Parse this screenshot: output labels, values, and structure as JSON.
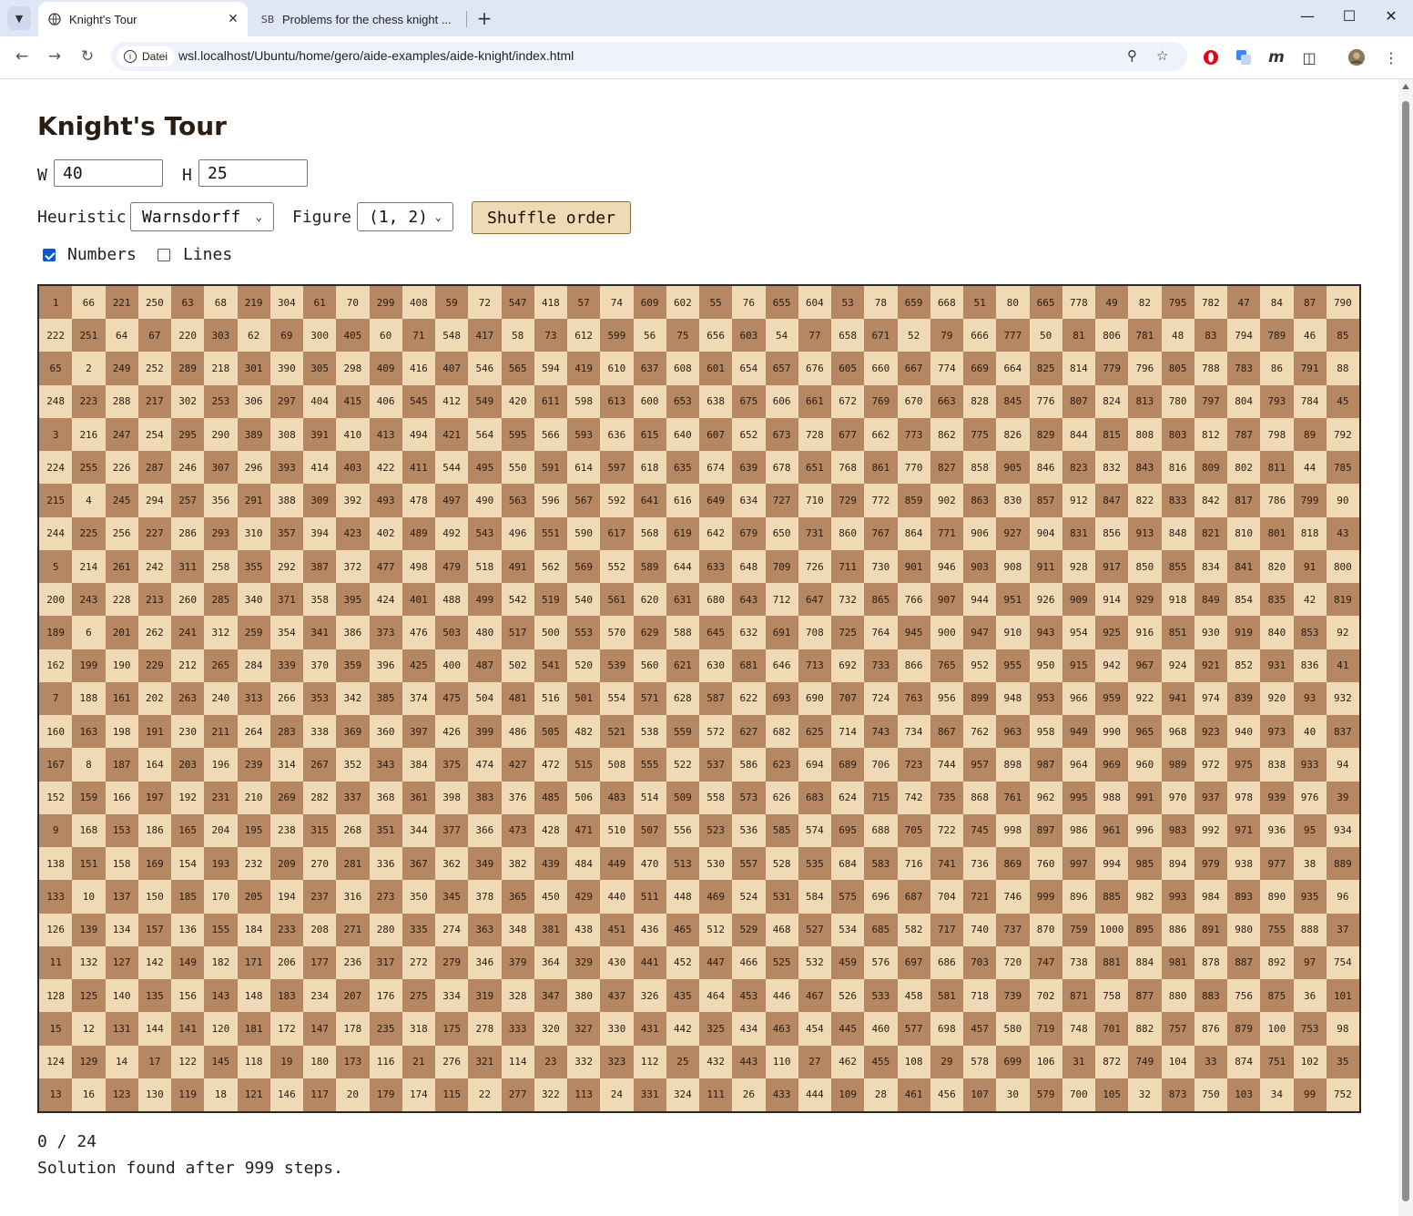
{
  "browser": {
    "tabs": [
      {
        "title": "Knight's Tour",
        "active": true
      },
      {
        "title": "Problems for the chess knight ...",
        "active": false,
        "favicon_text": "SB"
      }
    ],
    "security_chip": "Datei",
    "url": "wsl.localhost/Ubuntu/home/gero/aide-examples/aide-knight/index.html"
  },
  "page": {
    "title": "Knight's Tour",
    "w_label": "W",
    "w_value": "40",
    "h_label": "H",
    "h_value": "25",
    "heuristic_label": "Heuristic",
    "heuristic_value": "Warnsdorff",
    "figure_label": "Figure",
    "figure_value": "(1, 2)",
    "shuffle_label": "Shuffle order",
    "numbers_label": "Numbers",
    "numbers_checked": true,
    "lines_label": "Lines",
    "lines_checked": false,
    "counter": "0 / 24",
    "message": "Solution found after 999 steps."
  },
  "colors": {
    "light_square": "#f0d9b5",
    "dark_square": "#b58863",
    "button_bg": "#f0d9b5",
    "checkbox_accent": "#0b57d0"
  },
  "board": {
    "width": 40,
    "height": 25,
    "rows": [
      [
        1,
        66,
        221,
        250,
        63,
        68,
        219,
        304,
        61,
        70,
        299,
        408,
        59,
        72,
        547,
        418,
        57,
        74,
        609,
        602,
        55,
        76,
        655,
        604,
        53,
        78,
        659,
        668,
        51,
        80,
        665,
        778,
        49,
        82,
        795,
        782,
        47,
        84,
        87,
        790
      ],
      [
        222,
        251,
        64,
        67,
        220,
        303,
        62,
        69,
        300,
        405,
        60,
        71,
        548,
        417,
        58,
        73,
        612,
        599,
        56,
        75,
        656,
        603,
        54,
        77,
        658,
        671,
        52,
        79,
        666,
        777,
        50,
        81,
        806,
        781,
        48,
        83,
        794,
        789,
        46,
        85
      ],
      [
        65,
        2,
        249,
        252,
        289,
        218,
        301,
        390,
        305,
        298,
        409,
        416,
        407,
        546,
        565,
        594,
        419,
        610,
        637,
        608,
        601,
        654,
        657,
        676,
        605,
        660,
        667,
        774,
        669,
        664,
        825,
        814,
        779,
        796,
        805,
        788,
        783,
        86,
        791,
        88
      ],
      [
        248,
        223,
        288,
        217,
        302,
        253,
        306,
        297,
        404,
        415,
        406,
        545,
        412,
        549,
        420,
        611,
        598,
        613,
        600,
        653,
        638,
        675,
        606,
        661,
        672,
        769,
        670,
        663,
        828,
        845,
        776,
        807,
        824,
        813,
        780,
        797,
        804,
        793,
        784,
        45
      ],
      [
        3,
        216,
        247,
        254,
        295,
        290,
        389,
        308,
        391,
        410,
        413,
        494,
        421,
        564,
        595,
        566,
        593,
        636,
        615,
        640,
        607,
        652,
        673,
        728,
        677,
        662,
        773,
        862,
        775,
        826,
        829,
        844,
        815,
        808,
        803,
        812,
        787,
        798,
        89,
        792
      ],
      [
        224,
        255,
        226,
        287,
        246,
        307,
        296,
        393,
        414,
        403,
        422,
        411,
        544,
        495,
        550,
        591,
        614,
        597,
        618,
        635,
        674,
        639,
        678,
        651,
        768,
        861,
        770,
        827,
        858,
        905,
        846,
        823,
        832,
        843,
        816,
        809,
        802,
        811,
        44,
        785
      ],
      [
        215,
        4,
        245,
        294,
        257,
        356,
        291,
        388,
        309,
        392,
        493,
        478,
        497,
        490,
        563,
        596,
        567,
        592,
        641,
        616,
        649,
        634,
        727,
        710,
        729,
        772,
        859,
        902,
        863,
        830,
        857,
        912,
        847,
        822,
        833,
        842,
        817,
        786,
        799,
        90
      ],
      [
        244,
        225,
        256,
        227,
        286,
        293,
        310,
        357,
        394,
        423,
        402,
        489,
        492,
        543,
        496,
        551,
        590,
        617,
        568,
        619,
        642,
        679,
        650,
        731,
        860,
        767,
        864,
        771,
        906,
        927,
        904,
        831,
        856,
        913,
        848,
        821,
        810,
        801,
        818,
        43
      ],
      [
        5,
        214,
        261,
        242,
        311,
        258,
        355,
        292,
        387,
        372,
        477,
        498,
        479,
        518,
        491,
        562,
        569,
        552,
        589,
        644,
        633,
        648,
        709,
        726,
        711,
        730,
        901,
        946,
        903,
        908,
        911,
        928,
        917,
        850,
        855,
        834,
        841,
        820,
        91,
        800
      ],
      [
        200,
        243,
        228,
        213,
        260,
        285,
        340,
        371,
        358,
        395,
        424,
        401,
        488,
        499,
        542,
        519,
        540,
        561,
        620,
        631,
        680,
        643,
        712,
        647,
        732,
        865,
        766,
        907,
        944,
        951,
        926,
        909,
        914,
        929,
        918,
        849,
        854,
        835,
        42,
        819
      ],
      [
        189,
        6,
        201,
        262,
        241,
        312,
        259,
        354,
        341,
        386,
        373,
        476,
        503,
        480,
        517,
        500,
        553,
        570,
        629,
        588,
        645,
        632,
        691,
        708,
        725,
        764,
        945,
        900,
        947,
        910,
        943,
        954,
        925,
        916,
        851,
        930,
        919,
        840,
        853,
        92
      ],
      [
        162,
        199,
        190,
        229,
        212,
        265,
        284,
        339,
        370,
        359,
        396,
        425,
        400,
        487,
        502,
        541,
        520,
        539,
        560,
        621,
        630,
        681,
        646,
        713,
        692,
        733,
        866,
        765,
        952,
        955,
        950,
        915,
        942,
        967,
        924,
        921,
        852,
        931,
        836,
        41
      ],
      [
        7,
        188,
        161,
        202,
        263,
        240,
        313,
        266,
        353,
        342,
        385,
        374,
        475,
        504,
        481,
        516,
        501,
        554,
        571,
        628,
        587,
        622,
        693,
        690,
        707,
        724,
        763,
        956,
        899,
        948,
        953,
        966,
        959,
        922,
        941,
        974,
        839,
        920,
        93,
        932
      ],
      [
        160,
        163,
        198,
        191,
        230,
        211,
        264,
        283,
        338,
        369,
        360,
        397,
        426,
        399,
        486,
        505,
        482,
        521,
        538,
        559,
        572,
        627,
        682,
        625,
        714,
        743,
        734,
        867,
        762,
        963,
        958,
        949,
        990,
        965,
        968,
        923,
        940,
        973,
        40,
        837
      ],
      [
        167,
        8,
        187,
        164,
        203,
        196,
        239,
        314,
        267,
        352,
        343,
        384,
        375,
        474,
        427,
        472,
        515,
        508,
        555,
        522,
        537,
        586,
        623,
        694,
        689,
        706,
        723,
        744,
        957,
        898,
        987,
        964,
        969,
        960,
        989,
        972,
        975,
        838,
        933,
        94
      ],
      [
        152,
        159,
        166,
        197,
        192,
        231,
        210,
        269,
        282,
        337,
        368,
        361,
        398,
        383,
        376,
        485,
        506,
        483,
        514,
        509,
        558,
        573,
        626,
        683,
        624,
        715,
        742,
        735,
        868,
        761,
        962,
        995,
        988,
        991,
        970,
        937,
        978,
        939,
        976,
        39
      ],
      [
        9,
        168,
        153,
        186,
        165,
        204,
        195,
        238,
        315,
        268,
        351,
        344,
        377,
        366,
        473,
        428,
        471,
        510,
        507,
        556,
        523,
        536,
        585,
        574,
        695,
        688,
        705,
        722,
        745,
        998,
        897,
        986,
        961,
        996,
        983,
        992,
        971,
        936,
        95,
        934
      ],
      [
        138,
        151,
        158,
        169,
        154,
        193,
        232,
        209,
        270,
        281,
        336,
        367,
        362,
        349,
        382,
        439,
        484,
        449,
        470,
        513,
        530,
        557,
        528,
        535,
        684,
        583,
        716,
        741,
        736,
        869,
        760,
        997,
        994,
        985,
        894,
        979,
        938,
        977,
        38,
        889
      ],
      [
        133,
        10,
        137,
        150,
        185,
        170,
        205,
        194,
        237,
        316,
        273,
        350,
        345,
        378,
        365,
        450,
        429,
        440,
        511,
        448,
        469,
        524,
        531,
        584,
        575,
        696,
        687,
        704,
        721,
        746,
        999,
        896,
        885,
        982,
        993,
        984,
        893,
        890,
        935,
        96
      ],
      [
        126,
        139,
        134,
        157,
        136,
        155,
        184,
        233,
        208,
        271,
        280,
        335,
        274,
        363,
        348,
        381,
        438,
        451,
        436,
        465,
        512,
        529,
        468,
        527,
        534,
        685,
        582,
        717,
        740,
        737,
        870,
        759,
        1000,
        895,
        886,
        891,
        980,
        755,
        888,
        37
      ],
      [
        11,
        132,
        127,
        142,
        149,
        182,
        171,
        206,
        177,
        236,
        317,
        272,
        279,
        346,
        379,
        364,
        329,
        430,
        441,
        452,
        447,
        466,
        525,
        532,
        459,
        576,
        697,
        686,
        703,
        720,
        747,
        738,
        881,
        884,
        981,
        878,
        887,
        892,
        97,
        754
      ],
      [
        128,
        125,
        140,
        135,
        156,
        143,
        148,
        183,
        234,
        207,
        176,
        275,
        334,
        319,
        328,
        347,
        380,
        437,
        326,
        435,
        464,
        453,
        446,
        467,
        526,
        533,
        458,
        581,
        718,
        739,
        702,
        871,
        758,
        877,
        880,
        883,
        756,
        875,
        36,
        101
      ],
      [
        15,
        12,
        131,
        144,
        141,
        120,
        181,
        172,
        147,
        178,
        235,
        318,
        175,
        278,
        333,
        320,
        327,
        330,
        431,
        442,
        325,
        434,
        463,
        454,
        445,
        460,
        577,
        698,
        457,
        580,
        719,
        748,
        701,
        882,
        757,
        876,
        879,
        100,
        753,
        98
      ],
      [
        124,
        129,
        14,
        17,
        122,
        145,
        118,
        19,
        180,
        173,
        116,
        21,
        276,
        321,
        114,
        23,
        332,
        323,
        112,
        25,
        432,
        443,
        110,
        27,
        462,
        455,
        108,
        29,
        578,
        699,
        106,
        31,
        872,
        749,
        104,
        33,
        874,
        751,
        102,
        35
      ],
      [
        13,
        16,
        123,
        130,
        119,
        18,
        121,
        146,
        117,
        20,
        179,
        174,
        115,
        22,
        277,
        322,
        113,
        24,
        331,
        324,
        111,
        26,
        433,
        444,
        109,
        28,
        461,
        456,
        107,
        30,
        579,
        700,
        105,
        32,
        873,
        750,
        103,
        34,
        99,
        752
      ]
    ]
  }
}
